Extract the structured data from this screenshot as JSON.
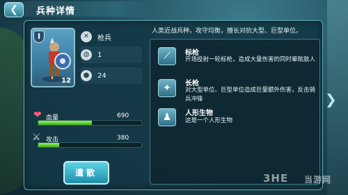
{
  "header": {
    "title": "兵种详情",
    "back_icon": "back-arrow-icon"
  },
  "unit": {
    "level": "I",
    "count": "12",
    "weapon_label": "枪兵",
    "stat_a": "1",
    "stat_b": "24"
  },
  "bars": {
    "hp_label": "血量",
    "hp_value": "690",
    "hp_fill": 0.52,
    "atk_label": "攻击",
    "atk_value": "380",
    "atk_fill": 0.2
  },
  "description": "人类近战兵种，攻守均衡，擅长对抗大型、巨型单位。",
  "skills": [
    {
      "name": "标枪",
      "desc": "开场投射一轮标枪，造成大量伤害的同时晕眩敌人",
      "icon": "javelin-icon"
    },
    {
      "name": "长枪",
      "desc": "对大型单位、巨型单位造成巨量额外伤害，反击骑兵冲锋",
      "icon": "spear-icon"
    },
    {
      "name": "人形生物",
      "desc": "这是一个人形生物",
      "icon": "humanoid-icon"
    }
  ],
  "dismiss_label": "遣散",
  "watermark": {
    "brand": "3HE",
    "site": "当游网"
  },
  "colors": {
    "accent": "#5fd3e6",
    "bar_fill": "#6fd63a",
    "panel": "#14374a"
  }
}
